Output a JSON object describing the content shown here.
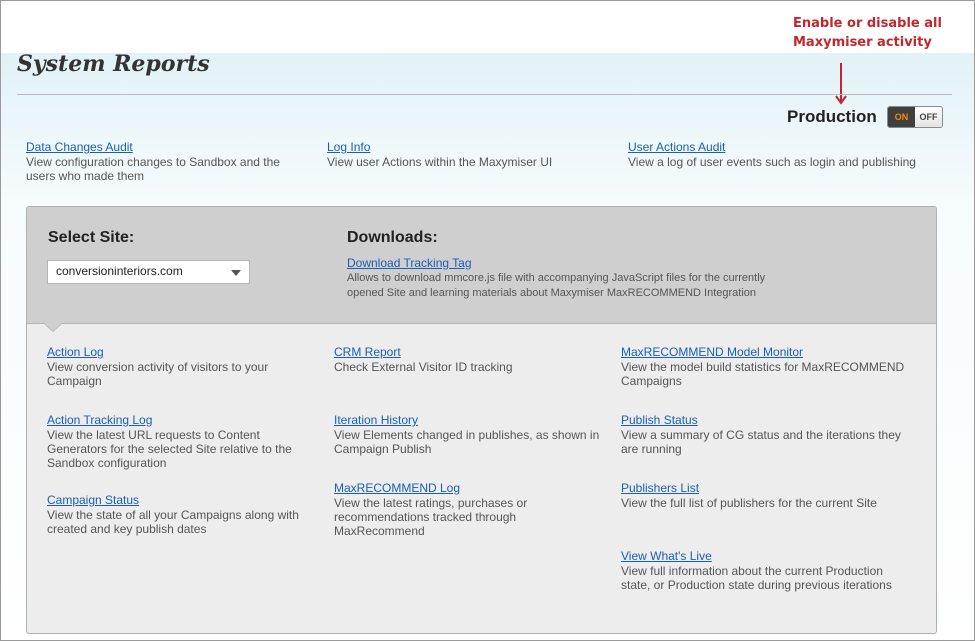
{
  "annotation": {
    "text": "Enable or disable all Maxymiser activity"
  },
  "page_title": "System Reports",
  "production": {
    "label": "Production",
    "on_label": "ON",
    "off_label": "OFF",
    "state": "on"
  },
  "top_links": [
    {
      "label": "Data Changes Audit",
      "desc": "View configuration changes to Sandbox and the users who made them"
    },
    {
      "label": "Log Info",
      "desc": "View user Actions within the Maxymiser UI"
    },
    {
      "label": "User Actions Audit",
      "desc": "View a log of user events such as login and publishing"
    }
  ],
  "select_site": {
    "heading": "Select Site:",
    "value": "conversioninteriors.com"
  },
  "downloads": {
    "heading": "Downloads:",
    "link": "Download Tracking Tag",
    "desc": "Allows to download mmcore.js file with accompanying JavaScript files for the currently opened Site and learning materials about Maxymiser MaxRECOMMEND Integration"
  },
  "reports": [
    [
      {
        "label": "Action Log",
        "desc": "View conversion activity of visitors to your Campaign"
      },
      {
        "label": "Action Tracking Log",
        "desc": "View the latest URL requests to Content Generators for the selected Site relative to the Sandbox configuration"
      },
      {
        "label": "Campaign Status",
        "desc": "View the state of all your Campaigns along with created and key publish dates"
      }
    ],
    [
      {
        "label": "CRM Report",
        "desc": "Check External Visitor ID tracking"
      },
      {
        "label": "Iteration History",
        "desc": "View Elements changed in publishes, as shown in Campaign Publish"
      },
      {
        "label": "MaxRECOMMEND Log",
        "desc": "View the latest ratings, purchases or recommendations tracked through MaxRecommend"
      }
    ],
    [
      {
        "label": "MaxRECOMMEND Model Monitor",
        "desc": "View the model build statistics for MaxRECOMMEND Campaigns"
      },
      {
        "label": "Publish Status",
        "desc": "View a summary of CG status and the iterations they are running"
      },
      {
        "label": "Publishers List",
        "desc": "View the full list of publishers for the current Site"
      },
      {
        "label": "View What's Live",
        "desc": "View full information about the current Production state, or Production state during previous iterations"
      }
    ]
  ]
}
